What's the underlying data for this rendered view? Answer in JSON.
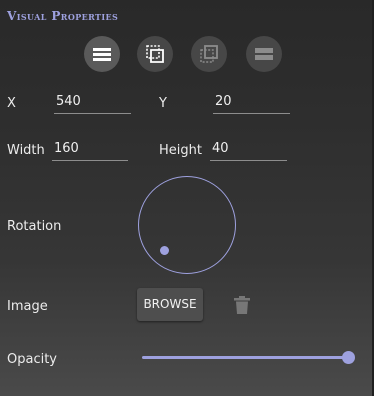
{
  "panel": {
    "title": "Visual Properties"
  },
  "toolbar": {
    "buttons": [
      {
        "icon": "align-lines-icon",
        "active": true
      },
      {
        "icon": "crop-select-icon",
        "active": false
      },
      {
        "icon": "layer-select-icon",
        "active": false
      },
      {
        "icon": "stack-lines-icon",
        "active": false
      }
    ]
  },
  "fields": {
    "x": {
      "label": "X",
      "value": "540"
    },
    "y": {
      "label": "Y",
      "value": "20"
    },
    "width": {
      "label": "Width",
      "value": "160"
    },
    "height": {
      "label": "Height",
      "value": "40"
    }
  },
  "rotation": {
    "label": "Rotation"
  },
  "image": {
    "label": "Image",
    "browse_label": "BROWSE",
    "delete_icon": "trash-icon"
  },
  "opacity": {
    "label": "Opacity",
    "value_fraction": 1.0
  },
  "colors": {
    "accent": "#9ea1df",
    "background": "#2e2e2e"
  }
}
